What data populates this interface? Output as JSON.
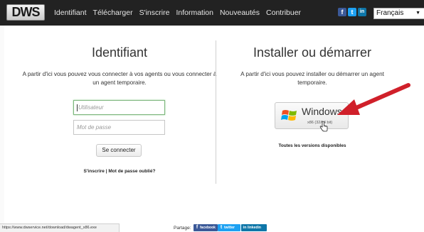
{
  "header": {
    "logo": "DWS",
    "nav": [
      "Identifiant",
      "Télécharger",
      "S'inscrire",
      "Information",
      "Nouveautés",
      "Contribuer"
    ],
    "social": [
      {
        "icon": "facebook-icon",
        "glyph": "f",
        "color": "#3b5998"
      },
      {
        "icon": "twitter-icon",
        "glyph": "t",
        "color": "#1da1f2"
      },
      {
        "icon": "linkedin-icon",
        "glyph": "in",
        "color": "#0e76a8"
      }
    ],
    "language": "Français"
  },
  "login": {
    "title": "Identifiant",
    "description": "A partir d'ici vous pouvez vous connecter à vos agents ou vous connecter à un agent temporaire.",
    "username_placeholder": "Utilisateur",
    "password_placeholder": "Mot de passe",
    "submit_label": "Se connecter",
    "links": "S'inscrire | Mot de passe oublié?"
  },
  "install": {
    "title": "Installer ou démarrer",
    "description": "A partir d'ici vous pouvez installer ou démarrer un agent temporaire.",
    "windows_label": "Windows",
    "windows_sub": "x86 (32/64 bit)",
    "all_versions": "Toutes les versions disponibles"
  },
  "footer": {
    "status_url": "https://www.dwservice.net/download/dwagent_x86.exe",
    "share_label": "Partage:",
    "share_buttons": [
      {
        "label": "facebook",
        "icon": "facebook-icon",
        "glyph": "f",
        "color": "#3b5998"
      },
      {
        "label": "twitter",
        "icon": "twitter-icon",
        "glyph": "t",
        "color": "#1da1f2"
      },
      {
        "label": "linkedin",
        "icon": "linkedin-icon",
        "glyph": "in",
        "color": "#0e76a8"
      }
    ]
  },
  "colors": {
    "topbar": "#222222",
    "accent_arrow": "#d0202a",
    "focus_border": "#7cb67c"
  }
}
